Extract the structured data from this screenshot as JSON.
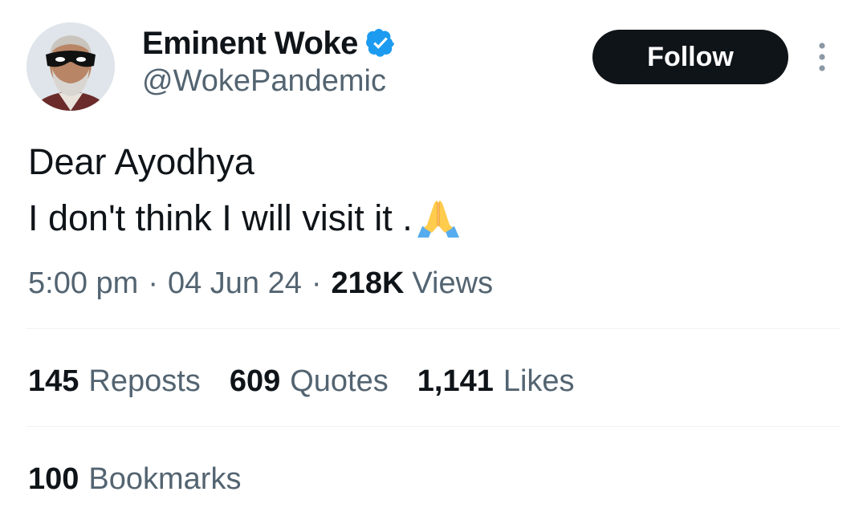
{
  "author": {
    "display_name": "Eminent Woke",
    "handle": "@WokePandemic",
    "verified_icon": "verified-badge-icon",
    "verified_color": "#1d9bf0"
  },
  "header": {
    "follow_label": "Follow",
    "more_icon": "more-vertical-icon"
  },
  "tweet": {
    "line1": "Dear Ayodhya",
    "line2": "I don't think I will visit it .",
    "emoji": "folded-hands-emoji"
  },
  "meta": {
    "time": "5:00 pm",
    "separator": "·",
    "date": "04 Jun 24",
    "views_count": "218K",
    "views_label": "Views"
  },
  "stats": {
    "reposts_count": "145",
    "reposts_label": "Reposts",
    "quotes_count": "609",
    "quotes_label": "Quotes",
    "likes_count": "1,141",
    "likes_label": "Likes",
    "bookmarks_count": "100",
    "bookmarks_label": "Bookmarks"
  },
  "colors": {
    "text_primary": "#0f1419",
    "text_secondary": "#536471",
    "divider": "#eff3f4",
    "follow_bg": "#0f1419"
  }
}
